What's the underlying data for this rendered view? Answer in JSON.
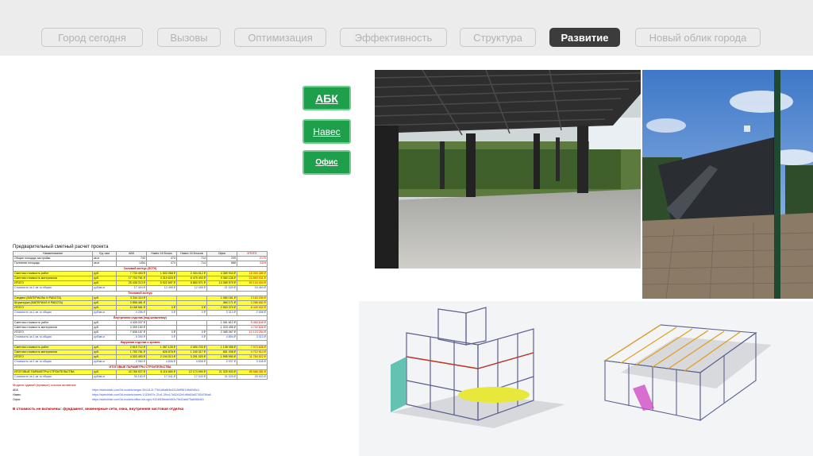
{
  "nav": {
    "tabs": [
      {
        "label": "Город сегодня",
        "active": false
      },
      {
        "label": "Вызовы",
        "active": false
      },
      {
        "label": "Оптимизация",
        "active": false
      },
      {
        "label": "Эффективность",
        "active": false
      },
      {
        "label": "Структура",
        "active": false
      },
      {
        "label": "Развитие",
        "active": true
      },
      {
        "label": "Новый облик города",
        "active": false
      }
    ]
  },
  "side_buttons": {
    "abk": "АБК",
    "naves": "Навес",
    "ofis": "Офис"
  },
  "colors": {
    "accent_green": "#1e9f4b",
    "active_tab": "#3c3c3c",
    "topbar_bg": "#ececec"
  },
  "estimate": {
    "title": "Предварительный сметный расчет проекта",
    "columns": [
      "Наименование",
      "Ед. изм",
      "АБК",
      "Навес 16 Блоки",
      "Навес 16 Блоков",
      "Офис",
      "ИТОГО"
    ],
    "area_rows": [
      [
        "Общая площадь застройки",
        "кв.м",
        "743",
        "474",
        "714",
        "239",
        "2170"
      ],
      [
        "Полезная площадь",
        "кв.м",
        "1454",
        "474",
        "714",
        "688",
        "3329"
      ]
    ],
    "sections": [
      {
        "title": "Силовой контур (ЛСТК)",
        "rows": [
          {
            "cells": [
              "Сметная стоимость работ",
              "руб.",
              "7 733 453 ₽",
              "1 603 068 ₽",
              "2 404 512 ₽",
              "4 389 934 ₽",
              "15 000 389 ₽"
            ],
            "hl": true
          },
          {
            "cells": [
              "Сметная стоимость материалов",
              "руб.",
              "17 704 761 ₽",
              "4 319 629 ₽",
              "6 479 403 ₽",
              "9 380 136 ₽",
              "24 883 931 ₽"
            ],
            "hl": true
          },
          {
            "cells": [
              "ИТОГО",
              "руб.",
              "25 438 213 ₽",
              "5 922 697 ₽",
              "8 883 971 ₽",
              "14 389 579 ₽",
              "50 134 404 ₽"
            ],
            "hl": true
          },
          {
            "cells": [
              "Стоимость за 1 кв. м общая",
              "руб/кв.м",
              "17 494 ₽",
              "12 495 ₽",
              "12 495 ₽",
              "21 029 ₽",
              "16 464 ₽"
            ],
            "hl": false,
            "blue": true
          }
        ]
      },
      {
        "title": "Тепловой контур",
        "rows": [
          {
            "cells": [
              "Сэндвич (МАТЕРИАЛЫ И РАБОТА)",
              "руб.",
              "3 334 110 ₽",
              "",
              "",
              "1 080 181 ₽",
              "3 163 250 ₽"
            ],
            "hl": true
          },
          {
            "cells": [
              "Штукатурка (МАТЕРИАЛ И РАБОТА)",
              "руб.",
              "2 856 481 ₽",
              "",
              "",
              "460 171 ₽",
              "3 286 652 ₽"
            ],
            "hl": true
          },
          {
            "cells": [
              "ИТОГО",
              "руб.",
              "6 188 581 ₽",
              "0 ₽",
              "0 ₽",
              "2 553 370 ₽",
              "8 449 902 ₽"
            ],
            "hl": true
          },
          {
            "cells": [
              "Стоимость за 1 кв. м общая",
              "руб/кв.м",
              "4 256 ₽",
              "0 ₽",
              "0 ₽",
              "3 313 ₽",
              "2 658 ₽"
            ],
            "hl": false,
            "blue": true
          }
        ]
      },
      {
        "title": "Внутренняя отделка (под шпаклевку)",
        "rows": [
          {
            "cells": [
              "Сметная стоимость работ",
              "руб.",
              "4 439 037 ₽",
              "",
              "",
              "1 061 612 ₽",
              "5 490 649 ₽"
            ],
            "hl": false
          },
          {
            "cells": [
              "Сметная стоимость материалов",
              "руб.",
              "3 399 150 ₽",
              "",
              "",
              "1 323 455 ₽",
              "4 722 605 ₽"
            ],
            "hl": false
          },
          {
            "cells": [
              "ИТОГО",
              "руб.",
              "7 838 187 ₽",
              "0 ₽",
              "0 ₽",
              "2 385 067 ₽",
              "10 123 254 ₽"
            ],
            "hl": false
          },
          {
            "cells": [
              "Стоимость за 1 кв. м общая",
              "руб/кв.м",
              "5 390 ₽",
              "0 ₽",
              "0 ₽",
              "4 894 ₽",
              "3 013 ₽"
            ],
            "hl": false,
            "blue": true
          }
        ]
      },
      {
        "title": "Наружная отделка и кровля",
        "rows": [
          {
            "cells": [
              "Сметная стоимость работ",
              "руб.",
              "2 519 712 ₽",
              "1 367 135 ₽",
              "2 050 703 ₽",
              "1 136 058 ₽",
              "7 073 608 ₽"
            ],
            "hl": true
          },
          {
            "cells": [
              "Сметная стоимость материалов",
              "руб.",
              "1 783 781 ₽",
              "826 878 ₽",
              "1 240 317 ₽",
              "861 938 ₽",
              "4 712 914 ₽"
            ],
            "hl": true
          },
          {
            "cells": [
              "ИТОГО",
              "руб.",
              "4 303 493 ₽",
              "2 194 013 ₽",
              "3 291 020 ₽",
              "1 995 990 ₽",
              "11 784 522 ₽"
            ],
            "hl": true
          },
          {
            "cells": [
              "Стоимость за 1 кв. м общая",
              "руб/кв.м",
              "2 960 ₽",
              "4 606 ₽",
              "4 608 ₽",
              "2 937 ₽",
              "3 545 ₽"
            ],
            "hl": false,
            "blue": true
          }
        ]
      },
      {
        "title": "ИТОГОВЫЕ ПАРАМЕТРЫ СТРОИТЕЛЬСТВА",
        "rows": [
          {
            "cells": [
              "ИТОГОВЫЕ ПАРАМЕТРЫ СТРОИТЕЛЬСТВА",
              "руб.",
              "43 768 527 ₽",
              "8 116 660 ₽",
              "12 174 990 ₽",
              "21 325 903 ₽",
              "85 586 081 ₽"
            ],
            "hl": true
          },
          {
            "cells": [
              "Стоимость за 1 кв. м общая",
              "руб/кв.м",
              "30 183 ₽",
              "17 041 ₽",
              "17 043 ₽",
              "31 025 ₽",
              "25 923 ₽"
            ],
            "hl": false,
            "blue": true
          }
        ]
      }
    ],
    "links_title": "Модели зданий (прямые) ссылки активные",
    "links": [
      {
        "k": "АБК",
        "v": "https://sketchfab.com/3d-models/angar-30x18-2f-77fd1d6a8f4e4312bff5611fb8045c4"
      },
      {
        "k": "Навес",
        "v": "https://sketchfab.com/3d-models/naves-1315b57e-21e1-39cd-7d02c32e1d6b63a573f2d7ff4a6"
      },
      {
        "k": "Офис",
        "v": "https://sketchfab.com/3d-models/office-lsh-ogni-9324f53bbde54f2c7fd42ab675ab98d461"
      }
    ],
    "note": "В стоимость не включены: фундамент, инженерные сети, окна, внутренняя чистовая отделка"
  }
}
